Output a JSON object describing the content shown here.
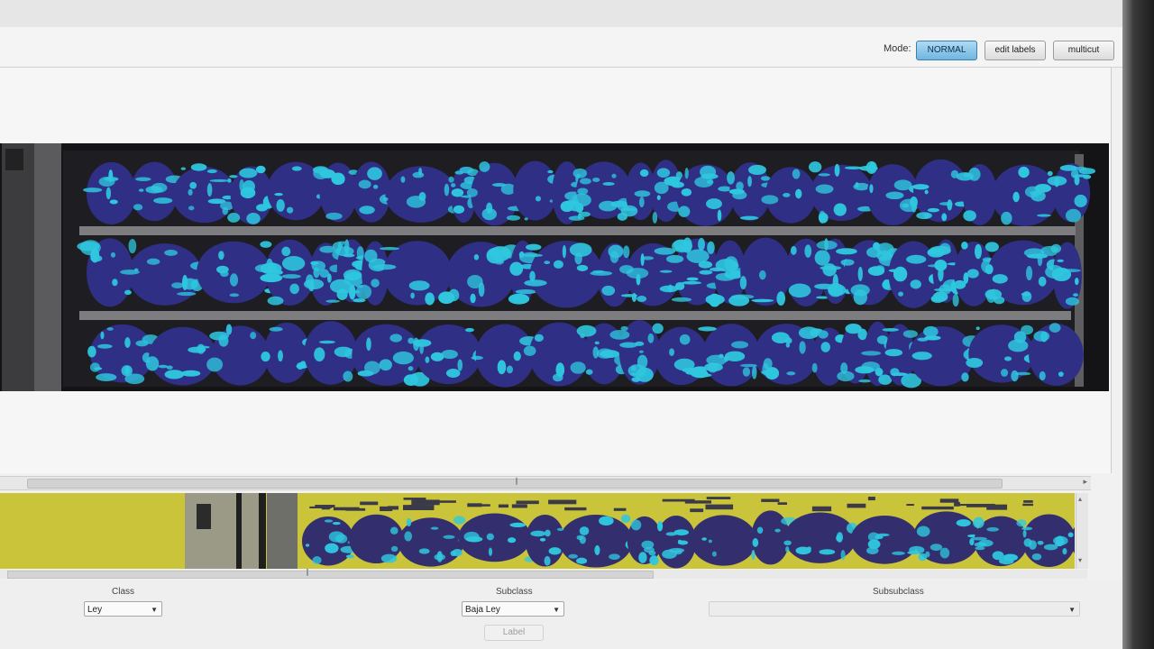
{
  "toolbar": {
    "mode_label": "Mode:",
    "buttons": [
      {
        "label": "NORMAL",
        "active": true
      },
      {
        "label": "edit labels",
        "active": false
      },
      {
        "label": "multicut",
        "active": false
      }
    ]
  },
  "scrollbar": {
    "grip": "∥"
  },
  "labeling": {
    "class": {
      "label": "Class",
      "value": "Ley"
    },
    "subclass": {
      "label": "Subclass",
      "value": "Baja Ley"
    },
    "subsubclass": {
      "label": "Subsubclass",
      "value": ""
    },
    "label_button": "Label"
  },
  "colors": {
    "accent": "#6fb6e0",
    "overlay_cyan": "#2fc7df",
    "rock_blue": "#2f2f86",
    "preview_yellow": "#c9c43a",
    "tray_gray": "#7a7a7a"
  }
}
